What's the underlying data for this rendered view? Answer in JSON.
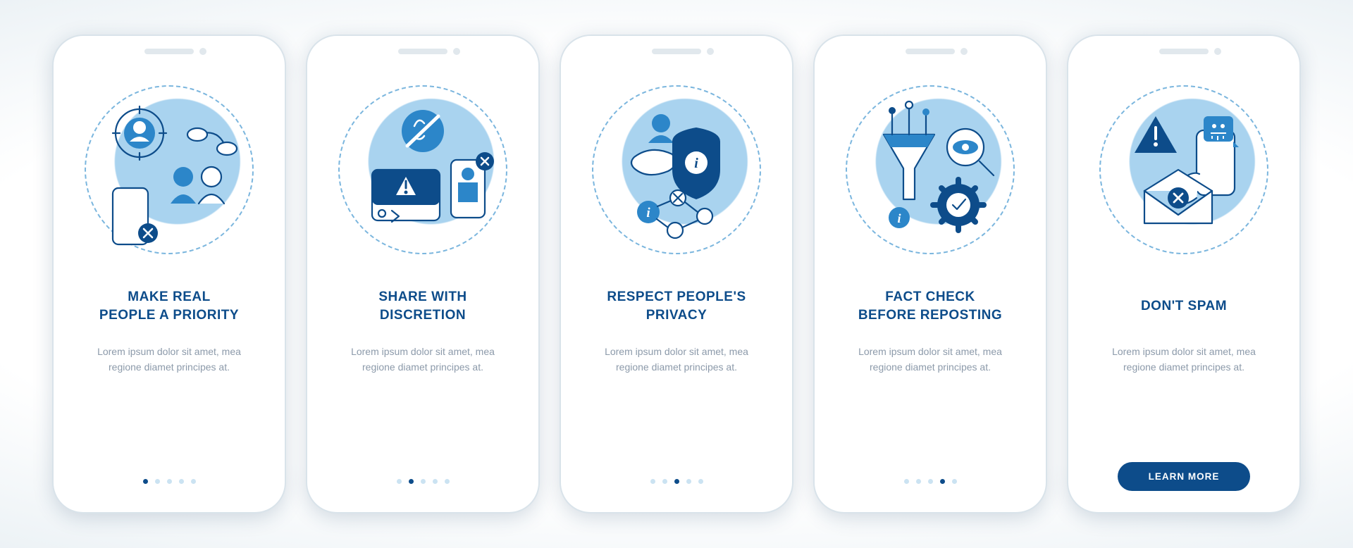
{
  "colors": {
    "primary": "#0D4C8A",
    "accent": "#2C86C9",
    "light": "#A9D3EF"
  },
  "body_text": "Lorem ipsum dolor sit amet, mea regione diamet principes at.",
  "cta_label": "LEARN MORE",
  "screens": [
    {
      "title": "MAKE REAL\nPEOPLE A PRIORITY",
      "icon": "real-people-icon",
      "active_dot": 0
    },
    {
      "title": "SHARE WITH\nDISCRETION",
      "icon": "discretion-icon",
      "active_dot": 1
    },
    {
      "title": "RESPECT PEOPLE'S\nPRIVACY",
      "icon": "privacy-icon",
      "active_dot": 2
    },
    {
      "title": "FACT CHECK\nBEFORE REPOSTING",
      "icon": "fact-check-icon",
      "active_dot": 3
    },
    {
      "title": "DON'T SPAM",
      "icon": "spam-icon",
      "active_dot": 4
    }
  ]
}
